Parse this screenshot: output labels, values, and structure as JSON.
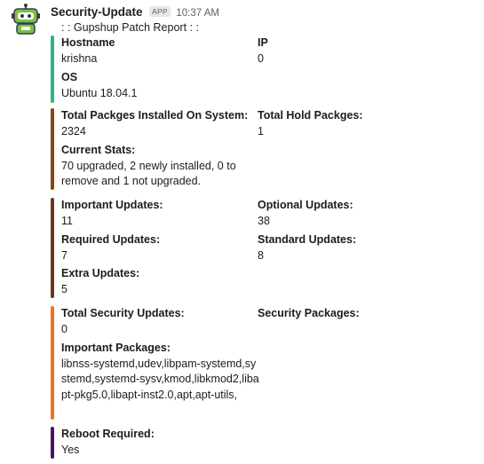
{
  "message": {
    "bot_name": "Security-Update",
    "badge": "APP",
    "timestamp": "10:37 AM",
    "title": ": : Gupshup Patch Report : :"
  },
  "attachments": [
    {
      "color": "#2eb67d",
      "fields": [
        {
          "title": "Hostname",
          "value": "krishna"
        },
        {
          "title": "IP",
          "value": "0"
        },
        {
          "title": "OS",
          "value": "Ubuntu 18.04.1"
        }
      ]
    },
    {
      "color": "#8b4513",
      "fields": [
        {
          "title": "Total Packges Installed On System:",
          "value": "2324"
        },
        {
          "title": "Total Hold Packges:",
          "value": "1"
        },
        {
          "title": "Current Stats:",
          "value": "70 upgraded, 2 newly installed, 0 to remove and 1 not upgraded."
        }
      ]
    },
    {
      "color": "#6b3a1e",
      "fields": [
        {
          "title": "Important Updates:",
          "value": "11"
        },
        {
          "title": "Optional Updates:",
          "value": "38"
        },
        {
          "title": "Required Updates:",
          "value": "7"
        },
        {
          "title": "Standard Updates:",
          "value": "8"
        },
        {
          "title": "Extra Updates:",
          "value": "5"
        }
      ]
    },
    {
      "color": "#f2711c",
      "fields": [
        {
          "title": "Total Security Updates:",
          "value": "0"
        },
        {
          "title": "Security Packages:",
          "value": ""
        },
        {
          "title": "Important Packages:",
          "value": "libnss-systemd,udev,libpam-systemd,systemd,systemd-sysv,kmod,libkmod2,libapt-pkg5.0,libapt-inst2.0,apt,apt-utils,"
        }
      ]
    },
    {
      "color": "#4a1560",
      "fields": [
        {
          "title": "Reboot Required:",
          "value": "Yes"
        }
      ]
    }
  ],
  "icons": {
    "avatar": "robot-avatar-icon"
  }
}
